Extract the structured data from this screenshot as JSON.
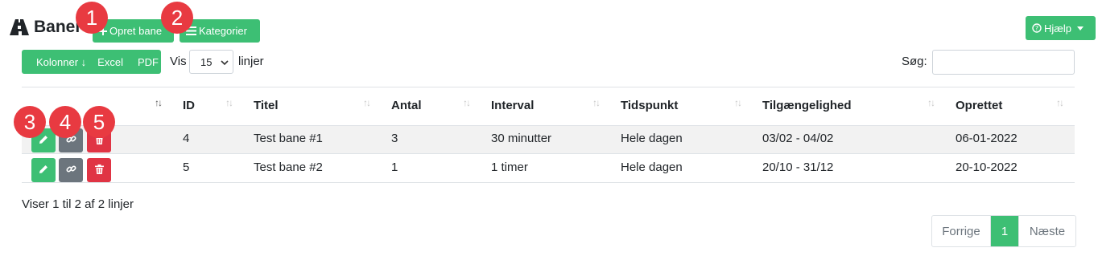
{
  "header": {
    "title": "Baner",
    "create_label": "Opret bane",
    "categories_label": "Kategorier",
    "help_label": "Hjælp"
  },
  "badges": [
    "1",
    "2",
    "3",
    "4",
    "5"
  ],
  "toolbar": {
    "columns_label": "Kolonner",
    "excel_label": "Excel",
    "pdf_label": "PDF",
    "show_label": "Vis",
    "page_size": "15",
    "lines_label": "linjer",
    "search_label": "Søg:",
    "search_value": ""
  },
  "table": {
    "headers": [
      "ID",
      "Titel",
      "Antal",
      "Interval",
      "Tidspunkt",
      "Tilgængelighed",
      "Oprettet"
    ],
    "rows": [
      {
        "id": "4",
        "title": "Test bane #1",
        "count": "3",
        "interval": "30 minutter",
        "time": "Hele dagen",
        "availability": "03/02 - 04/02",
        "created": "06-01-2022"
      },
      {
        "id": "5",
        "title": "Test bane #2",
        "count": "1",
        "interval": "1 timer",
        "time": "Hele dagen",
        "availability": "20/10 - 31/12",
        "created": "20-10-2022"
      }
    ]
  },
  "footer": {
    "info": "Viser 1 til 2 af 2 linjer",
    "prev_label": "Forrige",
    "current_page": "1",
    "next_label": "Næste"
  },
  "colors": {
    "accent_green": "#3dbf74",
    "danger_red": "#e03444",
    "secondary_gray": "#6c757d",
    "badge_red": "#e83a41"
  },
  "icons": [
    "road-icon",
    "plus-icon",
    "list-icon",
    "question-circle-icon",
    "caret-down-icon",
    "sort-icon",
    "pencil-icon",
    "link-icon",
    "trash-icon"
  ]
}
